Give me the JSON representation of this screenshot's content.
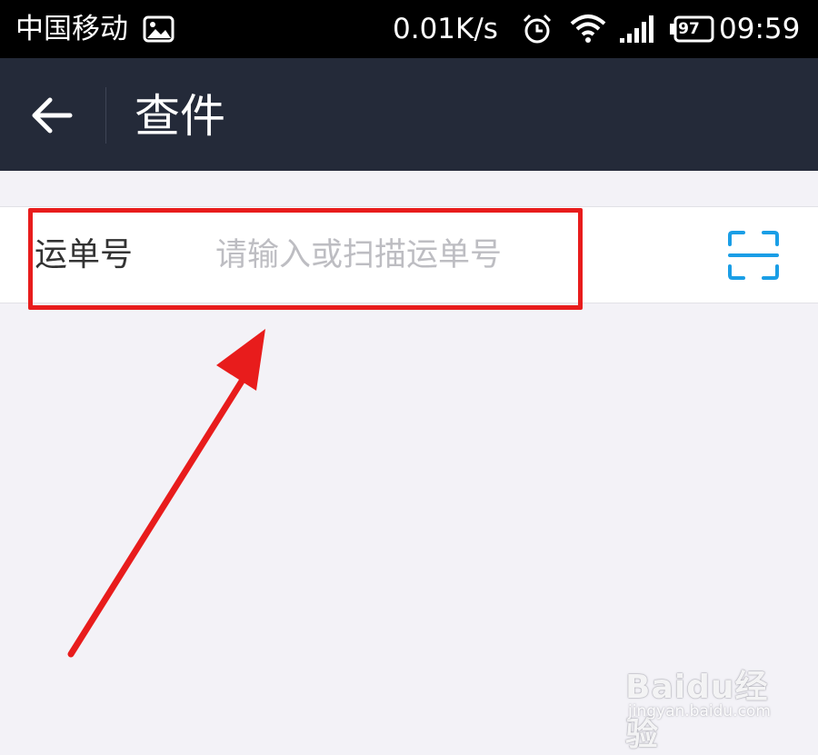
{
  "status_bar": {
    "carrier": "中国移动",
    "network_speed": "0.01K/s",
    "battery_level": "97",
    "time": "09:59",
    "icons": [
      "gallery-icon",
      "alarm-icon",
      "wifi-icon",
      "signal-icon",
      "battery-icon"
    ]
  },
  "app_bar": {
    "title": "查件",
    "back_icon": "back-arrow-icon",
    "background": "#242a39"
  },
  "waybill_field": {
    "label": "运单号",
    "value": "",
    "placeholder": "请输入或扫描运单号",
    "scan_icon": "scan-icon",
    "scan_color": "#1a9ee6"
  },
  "annotation": {
    "highlight_color": "#e81c1c"
  },
  "watermark": {
    "brand": "Baidu经验",
    "url": "jingyan.baidu.com"
  }
}
